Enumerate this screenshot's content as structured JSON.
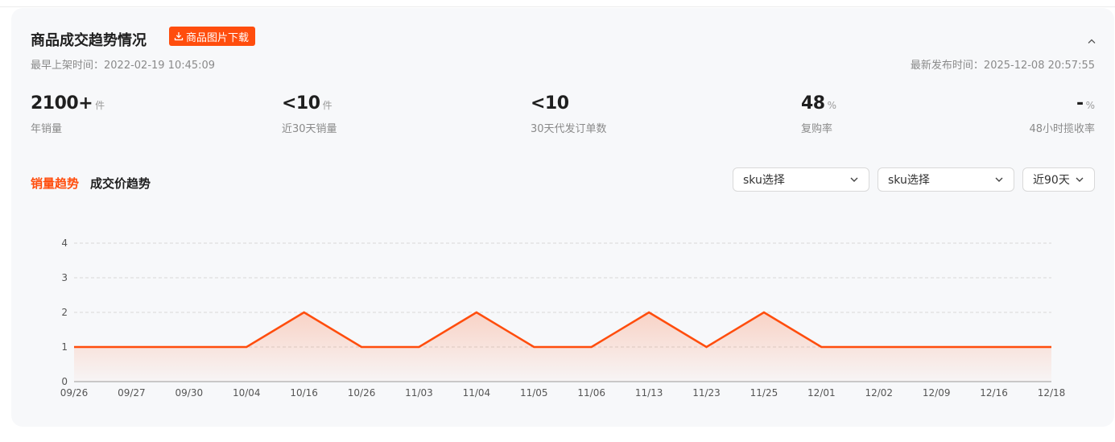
{
  "header": {
    "title": "商品成交趋势情况",
    "download_label": "商品图片下载",
    "first_listed": "最早上架时间：2022-02-19 10:45:09",
    "latest_published": "最新发布时间：2025-12-08 20:57:55"
  },
  "stats": [
    {
      "value": "2100+",
      "unit": "件",
      "label": "年销量"
    },
    {
      "value": "<10",
      "unit": "件",
      "label": "近30天销量"
    },
    {
      "value": "<10",
      "unit": "",
      "label": "30天代发订单数"
    },
    {
      "value": "48",
      "unit": "%",
      "label": "复购率"
    },
    {
      "value": "-",
      "unit": "%",
      "label": "48小时揽收率"
    }
  ],
  "tabs": {
    "sales_trend": "销量趋势",
    "price_trend": "成交价趋势"
  },
  "filters": {
    "sku1": "sku选择",
    "sku2": "sku选择",
    "range": "近90天"
  },
  "colors": {
    "accent": "#ff4d0d",
    "background": "#f7f8fa"
  },
  "chart_data": {
    "type": "area",
    "x": [
      "09/26",
      "09/27",
      "09/30",
      "10/04",
      "10/16",
      "10/26",
      "11/03",
      "11/04",
      "11/05",
      "11/06",
      "11/13",
      "11/23",
      "11/25",
      "12/01",
      "12/02",
      "12/09",
      "12/16",
      "12/18"
    ],
    "series": [
      {
        "values": [
          1,
          1,
          1,
          1,
          2,
          1,
          1,
          2,
          1,
          1,
          2,
          1,
          2,
          1,
          1,
          1,
          1,
          1
        ]
      }
    ],
    "yticks": [
      0,
      1,
      2,
      3,
      4
    ],
    "ylim": [
      0,
      4
    ],
    "grid": true,
    "title": "",
    "xlabel": "",
    "ylabel": ""
  }
}
